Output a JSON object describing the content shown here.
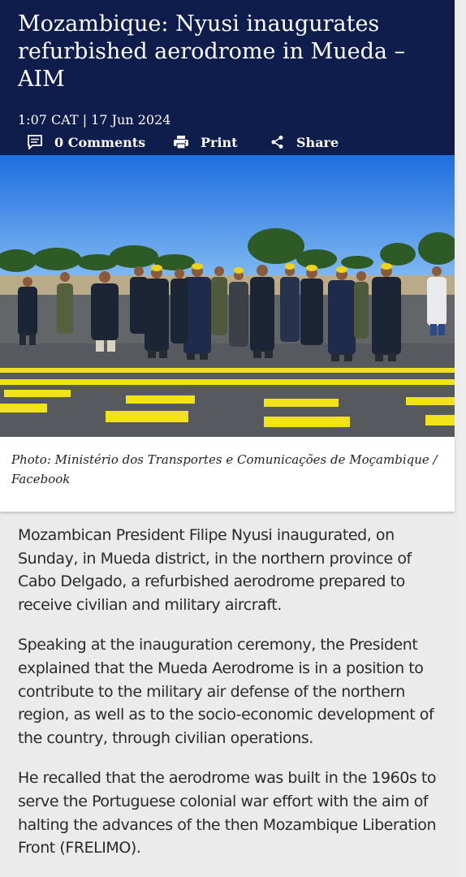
{
  "article": {
    "title": "Mozambique: Nyusi inaugurates refurbished aerodrome in Mueda – AIM",
    "timestamp": "1:07 CAT | 17 Jun 2024",
    "actions": {
      "comments": "0 Comments",
      "print": "Print",
      "share": "Share"
    },
    "photo_caption": "Photo: Ministério dos Transportes e Comunicações de Moçambique / Facebook",
    "paragraphs": [
      "Mozambican President Filipe Nyusi inaugurated, on Sunday, in Mueda district, in the northern province of Cabo Delgado, a refurbished aerodrome prepared to receive civilian and military aircraft.",
      "Speaking at the inauguration ceremony, the President explained that the Mueda Aerodrome is in a position to contribute to the military air defense of the northern region, as well as to the socio-economic development of the country, through civilian operations.",
      "He recalled that the aerodrome was built in the 1960s to serve the Portuguese colonial war effort with the aim of halting the advances of the then Mozambique Liberation Front (FRELIMO)."
    ]
  },
  "icons": {
    "comments": "comment-icon",
    "print": "print-icon",
    "share": "share-icon"
  },
  "colors": {
    "header_bg": "#0f1d4d",
    "runway_marking": "#f2e21a",
    "page_bg": "#ebebeb"
  }
}
